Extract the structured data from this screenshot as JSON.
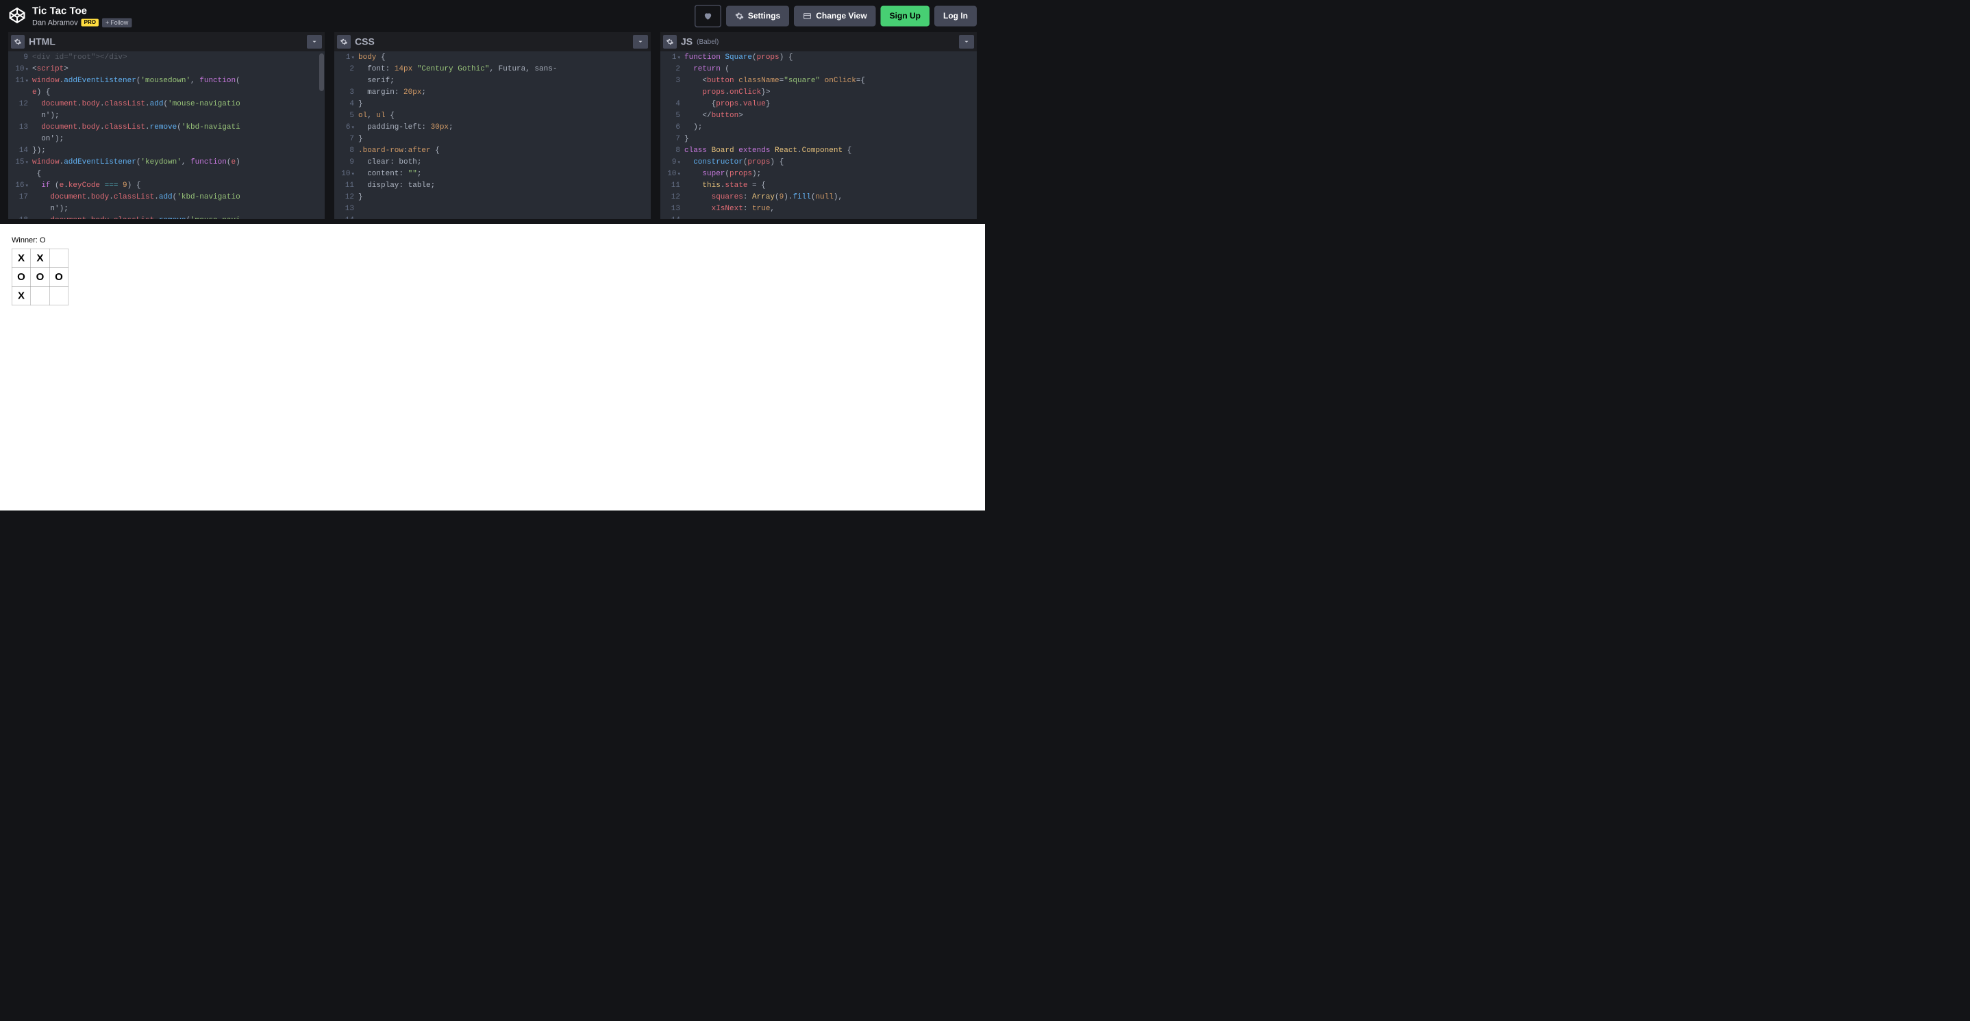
{
  "header": {
    "title": "Tic Tac Toe",
    "author": "Dan Abramov",
    "pro_badge": "PRO",
    "follow_label": "Follow",
    "settings_label": "Settings",
    "changeview_label": "Change View",
    "signup_label": "Sign Up",
    "login_label": "Log In"
  },
  "editors": {
    "html": {
      "title": "HTML",
      "first_line": 9,
      "lines": [
        {
          "raw": "<div id=\"root\"></div>",
          "indent": 0,
          "dim": true
        },
        {
          "tokens": [
            [
              "c-punc",
              "<"
            ],
            [
              "c-tag",
              "script"
            ],
            [
              "c-punc",
              ">"
            ]
          ],
          "indent": 0,
          "arrow": true
        },
        {
          "tokens": [
            [
              "c-var",
              "window"
            ],
            [
              "c-punc",
              "."
            ],
            [
              "c-fn",
              "addEventListener"
            ],
            [
              "c-punc",
              "("
            ],
            [
              "c-str",
              "'mousedown'"
            ],
            [
              "c-punc",
              ", "
            ],
            [
              "c-kw",
              "function"
            ],
            [
              "c-punc",
              "("
            ],
            [
              "c-var",
              "e"
            ],
            [
              "c-punc",
              ") {"
            ]
          ],
          "indent": 0,
          "arrow": true
        },
        {
          "tokens": [
            [
              "c-var",
              "document"
            ],
            [
              "c-punc",
              "."
            ],
            [
              "c-var",
              "body"
            ],
            [
              "c-punc",
              "."
            ],
            [
              "c-var",
              "classList"
            ],
            [
              "c-punc",
              "."
            ],
            [
              "c-fn",
              "add"
            ],
            [
              "c-punc",
              "("
            ],
            [
              "c-str",
              "'mouse-navigation'"
            ],
            [
              "c-punc",
              ");"
            ]
          ],
          "indent": 1
        },
        {
          "tokens": [
            [
              "c-var",
              "document"
            ],
            [
              "c-punc",
              "."
            ],
            [
              "c-var",
              "body"
            ],
            [
              "c-punc",
              "."
            ],
            [
              "c-var",
              "classList"
            ],
            [
              "c-punc",
              "."
            ],
            [
              "c-fn",
              "remove"
            ],
            [
              "c-punc",
              "("
            ],
            [
              "c-str",
              "'kbd-navigation'"
            ],
            [
              "c-punc",
              ");"
            ]
          ],
          "indent": 1
        },
        {
          "tokens": [
            [
              "c-punc",
              "});"
            ]
          ],
          "indent": 0
        },
        {
          "tokens": [
            [
              "c-var",
              "window"
            ],
            [
              "c-punc",
              "."
            ],
            [
              "c-fn",
              "addEventListener"
            ],
            [
              "c-punc",
              "("
            ],
            [
              "c-str",
              "'keydown'"
            ],
            [
              "c-punc",
              ", "
            ],
            [
              "c-kw",
              "function"
            ],
            [
              "c-punc",
              "("
            ],
            [
              "c-var",
              "e"
            ],
            [
              "c-punc",
              ") {"
            ]
          ],
          "indent": 0,
          "arrow": true
        },
        {
          "tokens": [
            [
              "c-kw",
              "if"
            ],
            [
              "c-punc",
              " ("
            ],
            [
              "c-var",
              "e"
            ],
            [
              "c-punc",
              "."
            ],
            [
              "c-var",
              "keyCode"
            ],
            [
              "c-punc",
              " "
            ],
            [
              "c-cmp",
              "==="
            ],
            [
              "c-punc",
              " "
            ],
            [
              "c-num",
              "9"
            ],
            [
              "c-punc",
              ") {"
            ]
          ],
          "indent": 1,
          "arrow": true
        },
        {
          "tokens": [
            [
              "c-var",
              "document"
            ],
            [
              "c-punc",
              "."
            ],
            [
              "c-var",
              "body"
            ],
            [
              "c-punc",
              "."
            ],
            [
              "c-var",
              "classList"
            ],
            [
              "c-punc",
              "."
            ],
            [
              "c-fn",
              "add"
            ],
            [
              "c-punc",
              "("
            ],
            [
              "c-str",
              "'kbd-navigation'"
            ],
            [
              "c-punc",
              ");"
            ]
          ],
          "indent": 2
        },
        {
          "tokens": [
            [
              "c-var",
              "document"
            ],
            [
              "c-punc",
              "."
            ],
            [
              "c-var",
              "body"
            ],
            [
              "c-punc",
              "."
            ],
            [
              "c-var",
              "classList"
            ],
            [
              "c-punc",
              "."
            ],
            [
              "c-fn",
              "remove"
            ],
            [
              "c-punc",
              "("
            ],
            [
              "c-str",
              "'mouse-navigation'"
            ],
            [
              "c-punc",
              ");"
            ]
          ],
          "indent": 2
        },
        {
          "tokens": [
            [
              "c-punc",
              "}"
            ]
          ],
          "indent": 1
        }
      ]
    },
    "css": {
      "title": "CSS",
      "first_line": 1,
      "lines": [
        {
          "tokens": [
            [
              "c-sel",
              "body"
            ],
            [
              "c-punc",
              " {"
            ]
          ],
          "indent": 0,
          "arrow": true
        },
        {
          "tokens": [
            [
              "c-cssprop",
              "font"
            ],
            [
              "c-punc",
              ": "
            ],
            [
              "c-num",
              "14px"
            ],
            [
              "c-punc",
              " "
            ],
            [
              "c-str",
              "\"Century Gothic\""
            ],
            [
              "c-punc",
              ", Futura, sans-serif;"
            ]
          ],
          "indent": 1
        },
        {
          "tokens": [
            [
              "c-cssprop",
              "margin"
            ],
            [
              "c-punc",
              ": "
            ],
            [
              "c-num",
              "20px"
            ],
            [
              "c-punc",
              ";"
            ]
          ],
          "indent": 1
        },
        {
          "tokens": [
            [
              "c-punc",
              "}"
            ]
          ],
          "indent": 0
        },
        {
          "tokens": [
            [
              "c-punc",
              ""
            ]
          ],
          "indent": 0
        },
        {
          "tokens": [
            [
              "c-sel",
              "ol"
            ],
            [
              "c-punc",
              ", "
            ],
            [
              "c-sel",
              "ul"
            ],
            [
              "c-punc",
              " {"
            ]
          ],
          "indent": 0,
          "arrow": true
        },
        {
          "tokens": [
            [
              "c-cssprop",
              "padding-left"
            ],
            [
              "c-punc",
              ": "
            ],
            [
              "c-num",
              "30px"
            ],
            [
              "c-punc",
              ";"
            ]
          ],
          "indent": 1
        },
        {
          "tokens": [
            [
              "c-punc",
              "}"
            ]
          ],
          "indent": 0
        },
        {
          "tokens": [
            [
              "c-punc",
              ""
            ]
          ],
          "indent": 0
        },
        {
          "tokens": [
            [
              "c-sel",
              ".board-row"
            ],
            [
              "c-punc",
              ":"
            ],
            [
              "c-sel",
              "after"
            ],
            [
              "c-punc",
              " {"
            ]
          ],
          "indent": 0,
          "arrow": true
        },
        {
          "tokens": [
            [
              "c-cssprop",
              "clear"
            ],
            [
              "c-punc",
              ": both;"
            ]
          ],
          "indent": 1
        },
        {
          "tokens": [
            [
              "c-cssprop",
              "content"
            ],
            [
              "c-punc",
              ": "
            ],
            [
              "c-str",
              "\"\""
            ],
            [
              "c-punc",
              ";"
            ]
          ],
          "indent": 1
        },
        {
          "tokens": [
            [
              "c-cssprop",
              "display"
            ],
            [
              "c-punc",
              ": table;"
            ]
          ],
          "indent": 1
        },
        {
          "tokens": [
            [
              "c-punc",
              "}"
            ]
          ],
          "indent": 0
        }
      ]
    },
    "js": {
      "title": "JS",
      "subtitle": "(Babel)",
      "first_line": 1,
      "lines": [
        {
          "tokens": [
            [
              "c-kw",
              "function"
            ],
            [
              "c-punc",
              " "
            ],
            [
              "c-fn",
              "Square"
            ],
            [
              "c-punc",
              "("
            ],
            [
              "c-var",
              "props"
            ],
            [
              "c-punc",
              ") {"
            ]
          ],
          "indent": 0,
          "arrow": true
        },
        {
          "tokens": [
            [
              "c-kw",
              "return"
            ],
            [
              "c-punc",
              " ("
            ]
          ],
          "indent": 1
        },
        {
          "tokens": [
            [
              "c-punc",
              "<"
            ],
            [
              "c-tag",
              "button"
            ],
            [
              "c-punc",
              " "
            ],
            [
              "c-attr",
              "className"
            ],
            [
              "c-punc",
              "="
            ],
            [
              "c-str",
              "\"square\""
            ],
            [
              "c-punc",
              " "
            ],
            [
              "c-attr",
              "onClick"
            ],
            [
              "c-punc",
              "={"
            ],
            [
              "c-var",
              "props"
            ],
            [
              "c-punc",
              "."
            ],
            [
              "c-var",
              "onClick"
            ],
            [
              "c-punc",
              "}>"
            ]
          ],
          "indent": 2
        },
        {
          "tokens": [
            [
              "c-punc",
              "{"
            ],
            [
              "c-var",
              "props"
            ],
            [
              "c-punc",
              "."
            ],
            [
              "c-var",
              "value"
            ],
            [
              "c-punc",
              "}"
            ]
          ],
          "indent": 3
        },
        {
          "tokens": [
            [
              "c-punc",
              "</"
            ],
            [
              "c-tag",
              "button"
            ],
            [
              "c-punc",
              ">"
            ]
          ],
          "indent": 2
        },
        {
          "tokens": [
            [
              "c-punc",
              ");"
            ]
          ],
          "indent": 1
        },
        {
          "tokens": [
            [
              "c-punc",
              "}"
            ]
          ],
          "indent": 0
        },
        {
          "tokens": [
            [
              "c-punc",
              ""
            ]
          ],
          "indent": 0
        },
        {
          "tokens": [
            [
              "c-kw",
              "class"
            ],
            [
              "c-punc",
              " "
            ],
            [
              "c-type",
              "Board"
            ],
            [
              "c-punc",
              " "
            ],
            [
              "c-kw",
              "extends"
            ],
            [
              "c-punc",
              " "
            ],
            [
              "c-type",
              "React"
            ],
            [
              "c-punc",
              "."
            ],
            [
              "c-type",
              "Component"
            ],
            [
              "c-punc",
              " {"
            ]
          ],
          "indent": 0,
          "arrow": true
        },
        {
          "tokens": [
            [
              "c-fn",
              "constructor"
            ],
            [
              "c-punc",
              "("
            ],
            [
              "c-var",
              "props"
            ],
            [
              "c-punc",
              ") {"
            ]
          ],
          "indent": 1,
          "arrow": true
        },
        {
          "tokens": [
            [
              "c-kw",
              "super"
            ],
            [
              "c-punc",
              "("
            ],
            [
              "c-var",
              "props"
            ],
            [
              "c-punc",
              ");"
            ]
          ],
          "indent": 2
        },
        {
          "tokens": [
            [
              "c-this",
              "this"
            ],
            [
              "c-punc",
              "."
            ],
            [
              "c-var",
              "state"
            ],
            [
              "c-punc",
              " = {"
            ]
          ],
          "indent": 2
        },
        {
          "tokens": [
            [
              "c-var",
              "squares"
            ],
            [
              "c-punc",
              ": "
            ],
            [
              "c-type",
              "Array"
            ],
            [
              "c-punc",
              "("
            ],
            [
              "c-num",
              "9"
            ],
            [
              "c-punc",
              ")."
            ],
            [
              "c-fn",
              "fill"
            ],
            [
              "c-punc",
              "("
            ],
            [
              "c-num",
              "null"
            ],
            [
              "c-punc",
              "),"
            ]
          ],
          "indent": 3
        },
        {
          "tokens": [
            [
              "c-var",
              "xIsNext"
            ],
            [
              "c-punc",
              ": "
            ],
            [
              "c-num",
              "true"
            ],
            [
              "c-punc",
              ","
            ]
          ],
          "indent": 3
        }
      ]
    }
  },
  "output": {
    "status": "Winner: O",
    "board": [
      [
        "X",
        "X",
        ""
      ],
      [
        "O",
        "O",
        "O"
      ],
      [
        "X",
        "",
        ""
      ]
    ]
  }
}
